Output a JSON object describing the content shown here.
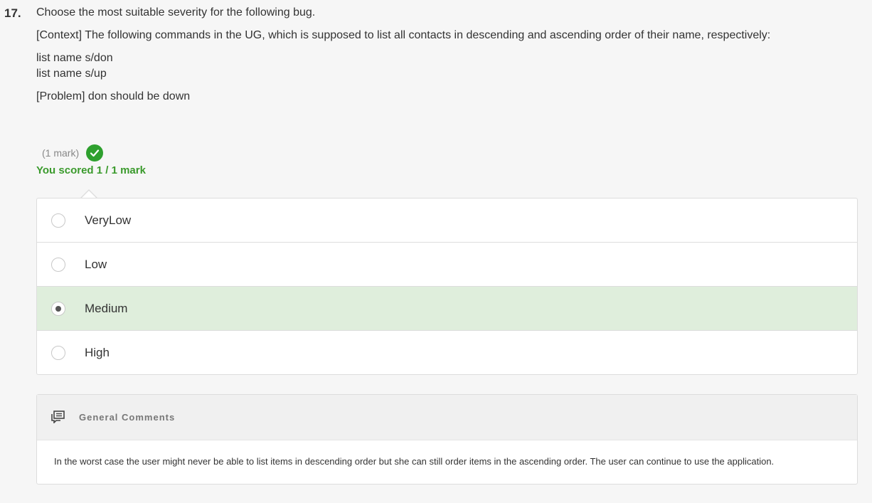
{
  "question": {
    "number": "17.",
    "prompt": "Choose the most suitable severity for the following bug.",
    "context": "[Context] The following commands in the UG, which is supposed to list all contacts in descending and ascending order of their name, respectively:",
    "code_lines": [
      "list name s/don",
      "list name s/up"
    ],
    "problem": "[Problem] don should be down"
  },
  "score": {
    "mark_text": "(1 mark)",
    "status_icon": "check-circle-icon",
    "status_color": "#2ea02e",
    "result_text": "You scored 1 / 1 mark"
  },
  "options": [
    {
      "label": "VeryLow",
      "selected": false
    },
    {
      "label": "Low",
      "selected": false
    },
    {
      "label": "Medium",
      "selected": true
    },
    {
      "label": "High",
      "selected": false
    }
  ],
  "comments": {
    "icon": "comments-icon",
    "title": "General Comments",
    "body": "In the worst case the user might never be able to list items in descending order but she can still order items in the ascending order. The user can continue to use the application."
  },
  "colors": {
    "selected_bg": "#dfeedc",
    "score_green": "#3a9a2c"
  }
}
